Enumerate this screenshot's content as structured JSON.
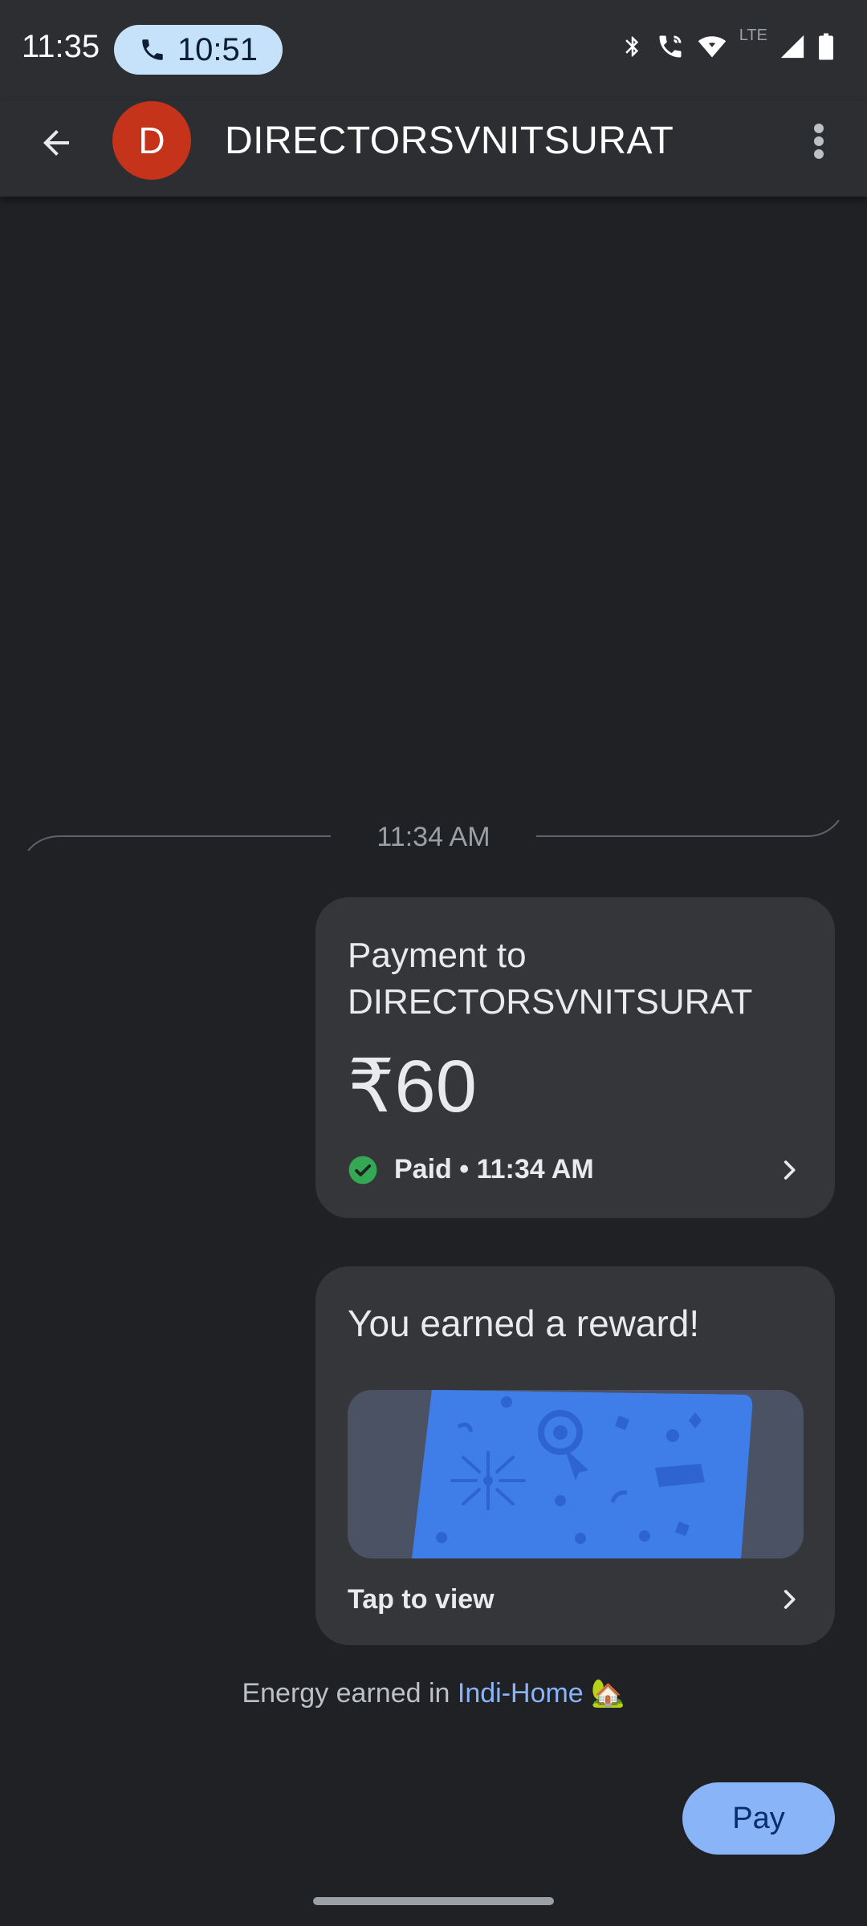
{
  "status_bar": {
    "time": "11:35",
    "call_timer": "10:51",
    "network_label": "LTE",
    "icons": [
      "bluetooth-icon",
      "call-icon",
      "wifi-icon",
      "signal-icon",
      "battery-icon"
    ]
  },
  "app_bar": {
    "avatar_letter": "D",
    "title": "DIRECTORSVNITSURAT",
    "avatar_color": "#c5331b"
  },
  "timestamp_separator": "11:34 AM",
  "payment_card": {
    "title": "Payment to DIRECTORSVNITSURAT",
    "amount": "₹60",
    "status": "Paid • 11:34 AM",
    "status_color": "#34a853"
  },
  "reward_card": {
    "title": "You earned a reward!",
    "action_label": "Tap to view"
  },
  "energy_note": {
    "prefix": "Energy earned in ",
    "link": "Indi-Home",
    "emoji": "🏡"
  },
  "pay_button": {
    "label": "Pay",
    "color": "#8ab4f8"
  }
}
